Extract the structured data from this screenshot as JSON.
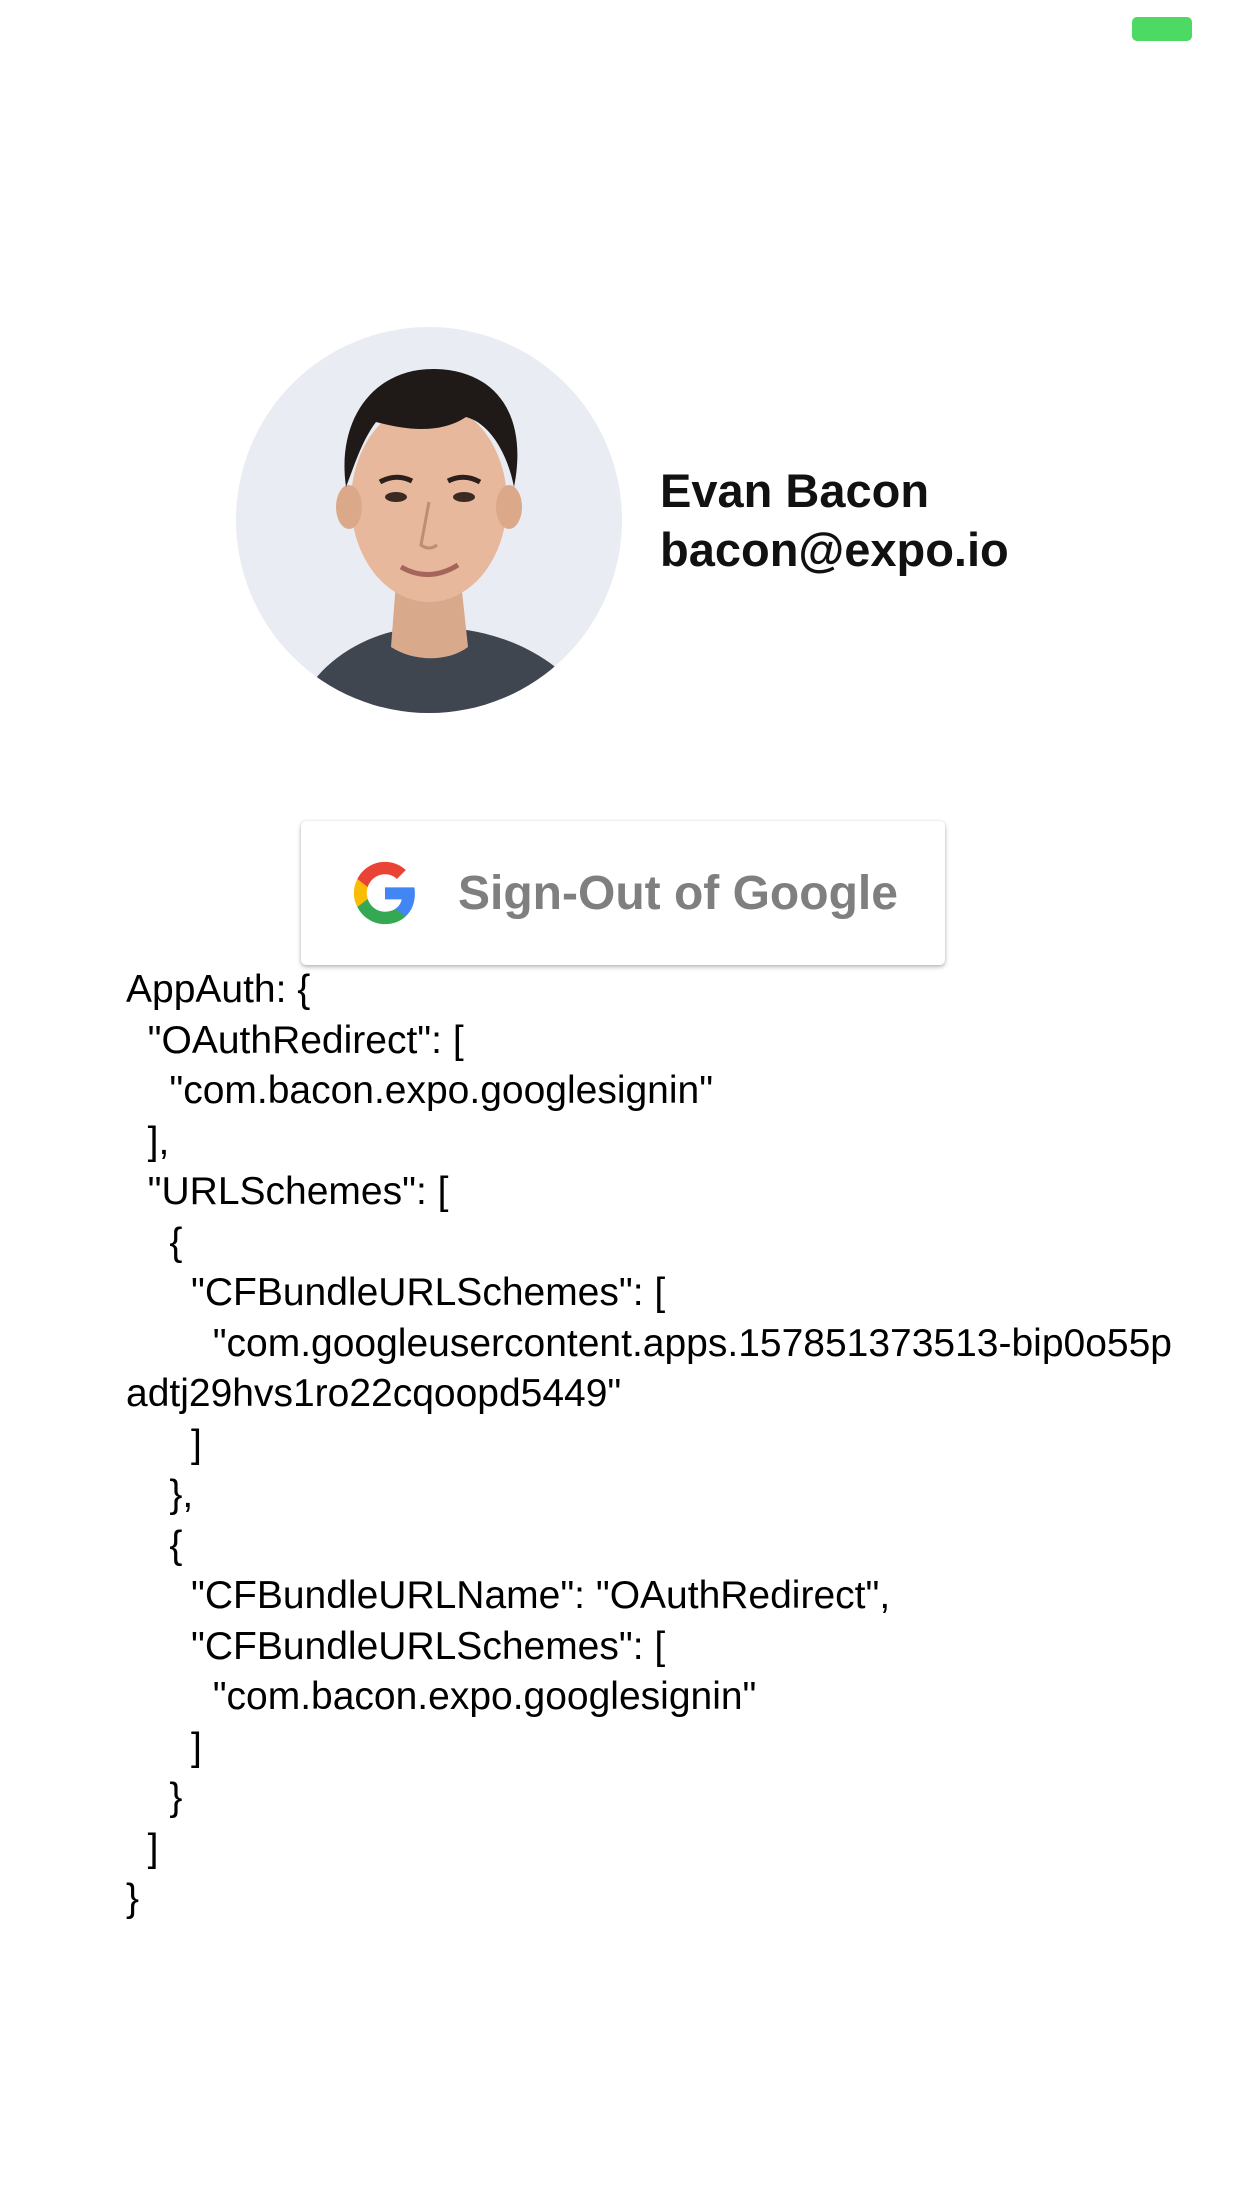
{
  "status_bar": {
    "battery_color": "#4cd964"
  },
  "profile": {
    "name": "Evan Bacon",
    "email": "bacon@expo.io",
    "avatar_icon": "user-photo"
  },
  "signout_button": {
    "label": "Sign-Out of Google",
    "icon": "google-g-logo",
    "label_color": "#7f7f7f"
  },
  "config": {
    "text": "AppAuth: {\n  \"OAuthRedirect\": [\n    \"com.bacon.expo.googlesignin\"\n  ],\n  \"URLSchemes\": [\n    {\n      \"CFBundleURLSchemes\": [\n        \"com.googleusercontent.apps.157851373513-bip0o55padtj29hvs1ro22cqoopd5449\"\n      ]\n    },\n    {\n      \"CFBundleURLName\": \"OAuthRedirect\",\n      \"CFBundleURLSchemes\": [\n        \"com.bacon.expo.googlesignin\"\n      ]\n    }\n  ]\n}"
  }
}
